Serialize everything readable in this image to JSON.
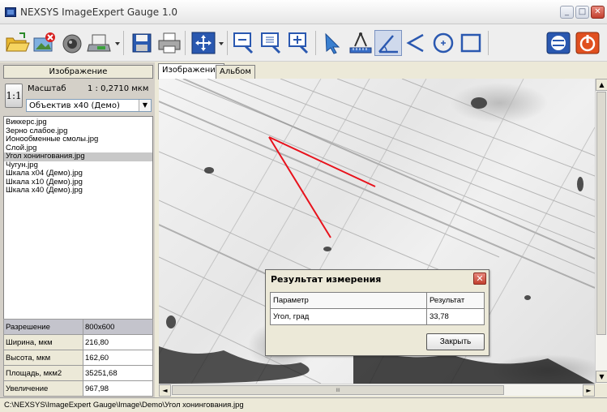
{
  "window": {
    "title": "NEXSYS ImageExpert Gauge 1.0",
    "min_glyph": "_",
    "max_glyph": "□",
    "close_glyph": "✕"
  },
  "toolbar": {
    "tools": [
      "open-folder-icon",
      "delete-image-icon",
      "camera-icon",
      "scanner-icon",
      "save-icon",
      "print-icon",
      "move-icon",
      "zoom-out-icon",
      "zoom-fit-icon",
      "zoom-in-icon",
      "pointer-icon",
      "length-measure-icon",
      "angle-measure-icon",
      "angle-open-icon",
      "circle-measure-icon",
      "rectangle-measure-icon",
      "calibrate-icon",
      "power-icon"
    ]
  },
  "left_panel": {
    "header": "Изображение",
    "scale_button": "1:1",
    "scale_label": "Масштаб",
    "scale_value": "1 : 0,2710 мкм",
    "objective": "Объектив х40 (Демо)",
    "files": [
      "Виккерс.jpg",
      "Зерно слабое.jpg",
      "Ионообменные смолы.jpg",
      "Слой.jpg",
      "Угол хонингования.jpg",
      "Чугун.jpg",
      "Шкала х04 (Демо).jpg",
      "Шкала х10 (Демо).jpg",
      "Шкала х40 (Демо).jpg"
    ],
    "selected_file_index": 4,
    "info": [
      {
        "key": "Разрешение",
        "value": "800x600"
      },
      {
        "key": "Ширина, мкм",
        "value": "216,80"
      },
      {
        "key": "Высота, мкм",
        "value": "162,60"
      },
      {
        "key": "Площадь, мкм2",
        "value": "35251,68"
      },
      {
        "key": "Увеличение",
        "value": "967,98"
      }
    ]
  },
  "tabs": [
    {
      "label": "Изображение",
      "active": true
    },
    {
      "label": "Альбом",
      "active": false
    }
  ],
  "measurement": {
    "color": "#e8121c"
  },
  "dialog": {
    "title": "Результат измерения",
    "close_glyph": "✕",
    "col_param": "Параметр",
    "col_result": "Результат",
    "row_param": "Угол, град",
    "row_result": "33,78",
    "close_button": "Закрыть"
  },
  "scroll": {
    "up": "▲",
    "down": "▼",
    "left": "◄",
    "right": "►",
    "grip": "III"
  },
  "status": {
    "path": "C:\\NEXSYS\\ImageExpert Gauge\\Image\\Demo\\Угол хонингования.jpg"
  }
}
